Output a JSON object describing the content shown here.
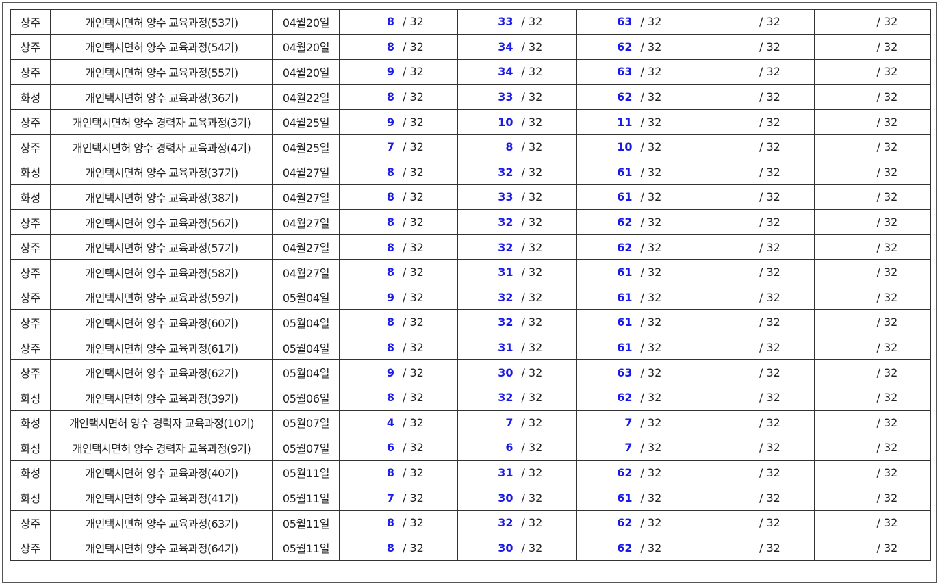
{
  "seat_separator": "/",
  "rows": [
    {
      "location": "상주",
      "course": "개인택시면허 양수 교육과정(53기)",
      "date": "04월20일",
      "seats": [
        {
          "count": "8",
          "total": "32"
        },
        {
          "count": "33",
          "total": "32"
        },
        {
          "count": "63",
          "total": "32"
        },
        {
          "count": "",
          "total": "32"
        },
        {
          "count": "",
          "total": "32"
        }
      ]
    },
    {
      "location": "상주",
      "course": "개인택시면허 양수 교육과정(54기)",
      "date": "04월20일",
      "seats": [
        {
          "count": "8",
          "total": "32"
        },
        {
          "count": "34",
          "total": "32"
        },
        {
          "count": "62",
          "total": "32"
        },
        {
          "count": "",
          "total": "32"
        },
        {
          "count": "",
          "total": "32"
        }
      ]
    },
    {
      "location": "상주",
      "course": "개인택시면허 양수 교육과정(55기)",
      "date": "04월20일",
      "seats": [
        {
          "count": "9",
          "total": "32"
        },
        {
          "count": "34",
          "total": "32"
        },
        {
          "count": "63",
          "total": "32"
        },
        {
          "count": "",
          "total": "32"
        },
        {
          "count": "",
          "total": "32"
        }
      ]
    },
    {
      "location": "화성",
      "course": "개인택시면허 양수 교육과정(36기)",
      "date": "04월22일",
      "seats": [
        {
          "count": "8",
          "total": "32"
        },
        {
          "count": "33",
          "total": "32"
        },
        {
          "count": "62",
          "total": "32"
        },
        {
          "count": "",
          "total": "32"
        },
        {
          "count": "",
          "total": "32"
        }
      ]
    },
    {
      "location": "상주",
      "course": "개인택시면허 양수 경력자 교육과정(3기)",
      "date": "04월25일",
      "seats": [
        {
          "count": "9",
          "total": "32"
        },
        {
          "count": "10",
          "total": "32"
        },
        {
          "count": "11",
          "total": "32"
        },
        {
          "count": "",
          "total": "32"
        },
        {
          "count": "",
          "total": "32"
        }
      ]
    },
    {
      "location": "상주",
      "course": "개인택시면허 양수 경력자 교육과정(4기)",
      "date": "04월25일",
      "seats": [
        {
          "count": "7",
          "total": "32"
        },
        {
          "count": "8",
          "total": "32"
        },
        {
          "count": "10",
          "total": "32"
        },
        {
          "count": "",
          "total": "32"
        },
        {
          "count": "",
          "total": "32"
        }
      ]
    },
    {
      "location": "화성",
      "course": "개인택시면허 양수 교육과정(37기)",
      "date": "04월27일",
      "seats": [
        {
          "count": "8",
          "total": "32"
        },
        {
          "count": "32",
          "total": "32"
        },
        {
          "count": "61",
          "total": "32"
        },
        {
          "count": "",
          "total": "32"
        },
        {
          "count": "",
          "total": "32"
        }
      ]
    },
    {
      "location": "화성",
      "course": "개인택시면허 양수 교육과정(38기)",
      "date": "04월27일",
      "seats": [
        {
          "count": "8",
          "total": "32"
        },
        {
          "count": "33",
          "total": "32"
        },
        {
          "count": "61",
          "total": "32"
        },
        {
          "count": "",
          "total": "32"
        },
        {
          "count": "",
          "total": "32"
        }
      ]
    },
    {
      "location": "상주",
      "course": "개인택시면허 양수 교육과정(56기)",
      "date": "04월27일",
      "seats": [
        {
          "count": "8",
          "total": "32"
        },
        {
          "count": "32",
          "total": "32"
        },
        {
          "count": "62",
          "total": "32"
        },
        {
          "count": "",
          "total": "32"
        },
        {
          "count": "",
          "total": "32"
        }
      ]
    },
    {
      "location": "상주",
      "course": "개인택시면허 양수 교육과정(57기)",
      "date": "04월27일",
      "seats": [
        {
          "count": "8",
          "total": "32"
        },
        {
          "count": "32",
          "total": "32"
        },
        {
          "count": "62",
          "total": "32"
        },
        {
          "count": "",
          "total": "32"
        },
        {
          "count": "",
          "total": "32"
        }
      ]
    },
    {
      "location": "상주",
      "course": "개인택시면허 양수 교육과정(58기)",
      "date": "04월27일",
      "seats": [
        {
          "count": "8",
          "total": "32"
        },
        {
          "count": "31",
          "total": "32"
        },
        {
          "count": "61",
          "total": "32"
        },
        {
          "count": "",
          "total": "32"
        },
        {
          "count": "",
          "total": "32"
        }
      ]
    },
    {
      "location": "상주",
      "course": "개인택시면허 양수 교육과정(59기)",
      "date": "05월04일",
      "seats": [
        {
          "count": "9",
          "total": "32"
        },
        {
          "count": "32",
          "total": "32"
        },
        {
          "count": "61",
          "total": "32"
        },
        {
          "count": "",
          "total": "32"
        },
        {
          "count": "",
          "total": "32"
        }
      ]
    },
    {
      "location": "상주",
      "course": "개인택시면허 양수 교육과정(60기)",
      "date": "05월04일",
      "seats": [
        {
          "count": "8",
          "total": "32"
        },
        {
          "count": "32",
          "total": "32"
        },
        {
          "count": "61",
          "total": "32"
        },
        {
          "count": "",
          "total": "32"
        },
        {
          "count": "",
          "total": "32"
        }
      ]
    },
    {
      "location": "상주",
      "course": "개인택시면허 양수 교육과정(61기)",
      "date": "05월04일",
      "seats": [
        {
          "count": "8",
          "total": "32"
        },
        {
          "count": "31",
          "total": "32"
        },
        {
          "count": "61",
          "total": "32"
        },
        {
          "count": "",
          "total": "32"
        },
        {
          "count": "",
          "total": "32"
        }
      ]
    },
    {
      "location": "상주",
      "course": "개인택시면허 양수 교육과정(62기)",
      "date": "05월04일",
      "seats": [
        {
          "count": "9",
          "total": "32"
        },
        {
          "count": "30",
          "total": "32"
        },
        {
          "count": "63",
          "total": "32"
        },
        {
          "count": "",
          "total": "32"
        },
        {
          "count": "",
          "total": "32"
        }
      ]
    },
    {
      "location": "화성",
      "course": "개인택시면허 양수 교육과정(39기)",
      "date": "05월06일",
      "seats": [
        {
          "count": "8",
          "total": "32"
        },
        {
          "count": "32",
          "total": "32"
        },
        {
          "count": "62",
          "total": "32"
        },
        {
          "count": "",
          "total": "32"
        },
        {
          "count": "",
          "total": "32"
        }
      ]
    },
    {
      "location": "화성",
      "course": "개인택시면허 양수 경력자 교육과정(10기)",
      "date": "05월07일",
      "seats": [
        {
          "count": "4",
          "total": "32"
        },
        {
          "count": "7",
          "total": "32"
        },
        {
          "count": "7",
          "total": "32"
        },
        {
          "count": "",
          "total": "32"
        },
        {
          "count": "",
          "total": "32"
        }
      ]
    },
    {
      "location": "화성",
      "course": "개인택시면허 양수 경력자 교육과정(9기)",
      "date": "05월07일",
      "seats": [
        {
          "count": "6",
          "total": "32"
        },
        {
          "count": "6",
          "total": "32"
        },
        {
          "count": "7",
          "total": "32"
        },
        {
          "count": "",
          "total": "32"
        },
        {
          "count": "",
          "total": "32"
        }
      ]
    },
    {
      "location": "화성",
      "course": "개인택시면허 양수 교육과정(40기)",
      "date": "05월11일",
      "seats": [
        {
          "count": "8",
          "total": "32"
        },
        {
          "count": "31",
          "total": "32"
        },
        {
          "count": "62",
          "total": "32"
        },
        {
          "count": "",
          "total": "32"
        },
        {
          "count": "",
          "total": "32"
        }
      ]
    },
    {
      "location": "화성",
      "course": "개인택시면허 양수 교육과정(41기)",
      "date": "05월11일",
      "seats": [
        {
          "count": "7",
          "total": "32"
        },
        {
          "count": "30",
          "total": "32"
        },
        {
          "count": "61",
          "total": "32"
        },
        {
          "count": "",
          "total": "32"
        },
        {
          "count": "",
          "total": "32"
        }
      ]
    },
    {
      "location": "상주",
      "course": "개인택시면허 양수 교육과정(63기)",
      "date": "05월11일",
      "seats": [
        {
          "count": "8",
          "total": "32"
        },
        {
          "count": "32",
          "total": "32"
        },
        {
          "count": "62",
          "total": "32"
        },
        {
          "count": "",
          "total": "32"
        },
        {
          "count": "",
          "total": "32"
        }
      ]
    },
    {
      "location": "상주",
      "course": "개인택시면허 양수 교육과정(64기)",
      "date": "05월11일",
      "seats": [
        {
          "count": "8",
          "total": "32"
        },
        {
          "count": "30",
          "total": "32"
        },
        {
          "count": "62",
          "total": "32"
        },
        {
          "count": "",
          "total": "32"
        },
        {
          "count": "",
          "total": "32"
        }
      ]
    }
  ],
  "colors": {
    "count_text": "#1a1ae6",
    "body_text": "#222222",
    "border": "#333333"
  }
}
